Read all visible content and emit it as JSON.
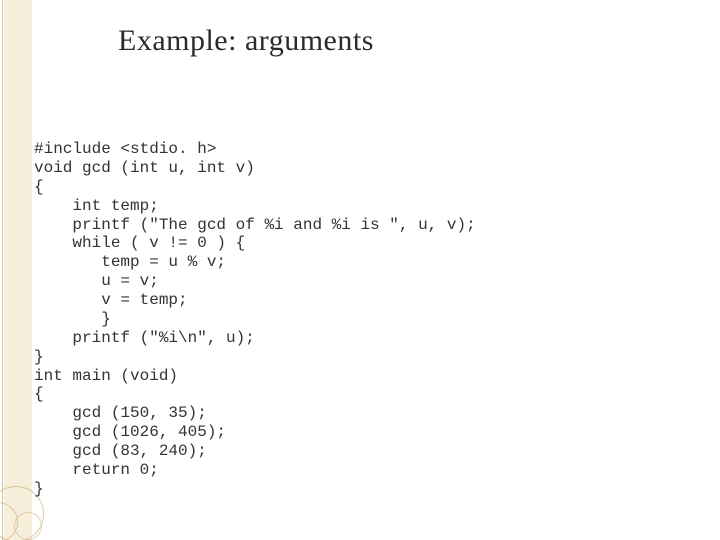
{
  "title": "Example: arguments",
  "code": {
    "l01": "#include <stdio. h>",
    "l02": "void gcd (int u, int v)",
    "l03": "{",
    "l04": "    int temp;",
    "l05": "    printf (\"The gcd of %i and %i is \", u, v);",
    "l06": "    while ( v != 0 ) {",
    "l07": "       temp = u % v;",
    "l08": "       u = v;",
    "l09": "       v = temp;",
    "l10": "       }",
    "l11": "    printf (\"%i\\n\", u);",
    "l12": "}",
    "l13": "int main (void)",
    "l14": "{",
    "l15": "    gcd (150, 35);",
    "l16": "    gcd (1026, 405);",
    "l17": "    gcd (83, 240);",
    "l18": "    return 0;",
    "l19": "}"
  }
}
